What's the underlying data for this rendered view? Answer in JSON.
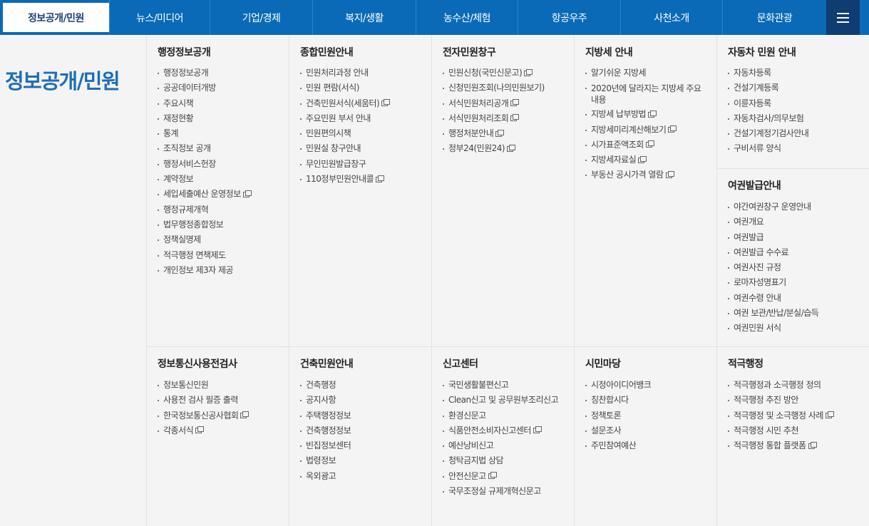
{
  "nav": {
    "tabs": [
      "정보공개/민원",
      "뉴스/미디어",
      "기업/경제",
      "복지/생활",
      "농수산/체험",
      "항공우주",
      "사천소개",
      "문화관광"
    ],
    "menu_icon": "hamburger-icon"
  },
  "sidebar": {
    "title": "정보공개/민원"
  },
  "groups": {
    "g1": {
      "title": "행정정보공개",
      "items": [
        "행정정보공개",
        "공공데이터개방",
        "주요시책",
        "재정현황",
        "통계",
        "조직정보 공개",
        "행정서비스헌장",
        "계약정보",
        "세입세출예산 운영정보",
        "행정규제개혁",
        "법무행정종합정보",
        "정책실명제",
        "적극행정 면책제도",
        "개인정보 제3자 제공"
      ]
    },
    "g2": {
      "title": "종합민원안내",
      "items": [
        "민원처리과정 안내",
        "민원 편람(서식)",
        "건축민원서식(세움터)",
        "주요민원 부서 안내",
        "민원편의시책",
        "민원실 창구안내",
        "무인민원발급창구",
        "110정부민원안내콜"
      ]
    },
    "g3": {
      "title": "전자민원창구",
      "items": [
        "민원신청(국민신문고)",
        "신청민원조회(나의민원보기)",
        "서식민원처리공개",
        "서식민원처리조회",
        "행정처분안내",
        "정부24(민원24)"
      ]
    },
    "g4": {
      "title": "지방세 안내",
      "items": [
        "알기쉬운 지방세",
        "2020년에 달라지는 지방세 주요 내용",
        "지방세 납부방법",
        "지방세미리계산해보기",
        "시가표준액조회",
        "지방세자료실",
        "부동산 공시가격 열람"
      ]
    },
    "g5": {
      "title": "자동차 민원 안내",
      "items": [
        "자동차등록",
        "건설기계등록",
        "이륜자등록",
        "자동차검사/의무보험",
        "건설기계정기검사안내",
        "구비서류 양식"
      ]
    },
    "g6": {
      "title": "여권발급안내",
      "items": [
        "야간여권창구 운영안내",
        "여권개요",
        "여권발급",
        "여권발급 수수료",
        "여권사진 규정",
        "로마자성명표기",
        "여권수령 안내",
        "여권 보관/반납/분실/습득",
        "여권민원 서식"
      ]
    },
    "g7": {
      "title": "정보통신사용전검사",
      "items": [
        "정보통신민원",
        "사용전 검사 필증 출력",
        "한국정보통신공사협회",
        "각종서식"
      ]
    },
    "g8": {
      "title": "건축민원안내",
      "items": [
        "건축행정",
        "공지사항",
        "주택행정정보",
        "건축행정정보",
        "빈집정보센터",
        "법령정보",
        "옥외광고"
      ]
    },
    "g9": {
      "title": "신고센터",
      "items": [
        "국민생활불편신고",
        "Clean신고 및 공무원부조리신고",
        "환경신문고",
        "식품안전소비자신고센터",
        "예산낭비신고",
        "청탁금지법 상담",
        "안전신문고",
        "국무조정실 규제개혁신문고"
      ]
    },
    "g10": {
      "title": "시민마당",
      "items": [
        "시정아이디어뱅크",
        "칭찬합시다",
        "정책토론",
        "설문조사",
        "주민참여예산"
      ]
    },
    "g11": {
      "title": "적극행정",
      "items": [
        "적극행정과 소극행정 정의",
        "적극행정 추진 방안",
        "적극행정 및 소극행정 사례",
        "적극행정 시민 추천",
        "적극행정 통합 플랫폼"
      ]
    }
  }
}
